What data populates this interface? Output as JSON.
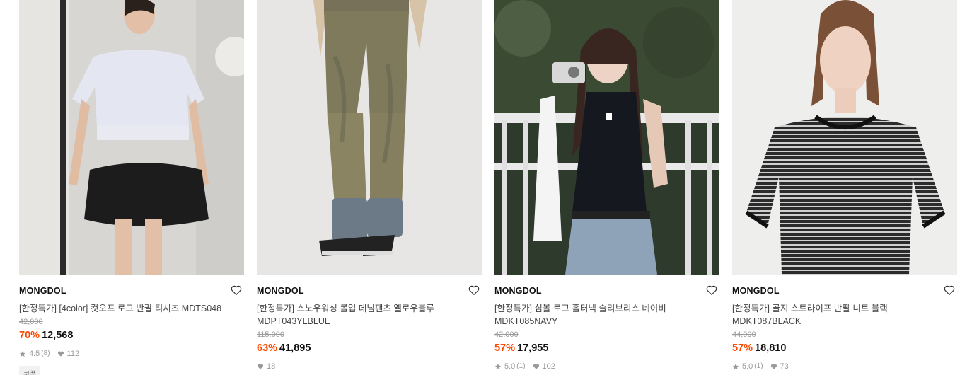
{
  "products": [
    {
      "brand": "MONGDOL",
      "name": "[한정특가] [4color] 컷오프 로고 반팔 티셔츠 MDTS048",
      "original_price": "42,000",
      "discount": "70%",
      "price": "12,568",
      "rating": "4.5",
      "review_count": "(8)",
      "likes": "112",
      "tag": "쿠폰"
    },
    {
      "brand": "MONGDOL",
      "name": "[한정특가] 스노우워싱 롤업 데님팬츠 옐로우블루 MDPT043YLBLUE",
      "original_price": "115,000",
      "discount": "63%",
      "price": "41,895",
      "likes": "18"
    },
    {
      "brand": "MONGDOL",
      "name": "[한정특가] 심볼 로고 홀터넥 슬리브리스 네이비 MDKT085NAVY",
      "original_price": "42,000",
      "discount": "57%",
      "price": "17,955",
      "rating": "5.0",
      "review_count": "(1)",
      "likes": "102"
    },
    {
      "brand": "MONGDOL",
      "name": "[한정특가] 골지 스트라이프 반팔 니트 블랙 MDKT087BLACK",
      "original_price": "44,000",
      "discount": "57%",
      "price": "18,810",
      "rating": "5.0",
      "review_count": "(1)",
      "likes": "73"
    }
  ],
  "colors": {
    "discount": "#ff4800",
    "muted": "#9a9a9a"
  },
  "icons": {
    "wishlist": "heart-outline-icon",
    "rating": "star-icon",
    "likes": "heart-filled-icon"
  }
}
